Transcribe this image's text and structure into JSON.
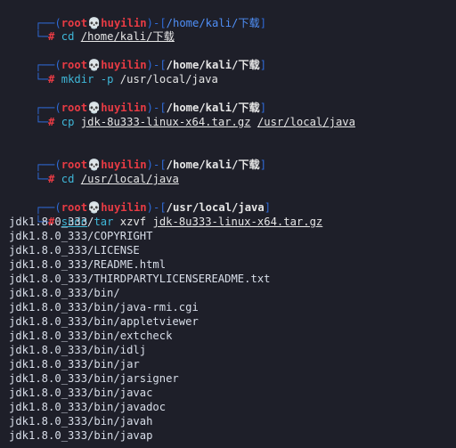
{
  "prompt": {
    "top_prefix": "┌──(",
    "user": "root",
    "skull": "💀",
    "host": "huyilin",
    "sep": ")-[",
    "close": "]",
    "bottom": "└─",
    "hash": "#"
  },
  "blocks": [
    {
      "cwd": "/home/kali/下载",
      "cmd": "cd",
      "args": [
        "/home/kali/下载"
      ]
    },
    {
      "cwd": "/home/kali/下载",
      "cmd": "mkdir",
      "args": [
        "-p",
        "/usr/local/java"
      ]
    },
    {
      "cwd": "/home/kali/下载",
      "cmd": "cp",
      "args": [
        "jdk-8u333-linux-x64.tar.gz",
        "/usr/local/java"
      ]
    },
    {
      "cwd": "/home/kali/下载",
      "cmd": "cd",
      "args": [
        "/usr/local/java"
      ]
    },
    {
      "cwd": "/usr/local/java",
      "cmd": "sudo",
      "args": [
        "tar",
        "xzvf",
        "jdk-8u333-linux-x64.tar.gz"
      ]
    }
  ],
  "output": [
    "jdk1.8.0_333/",
    "jdk1.8.0_333/COPYRIGHT",
    "jdk1.8.0_333/LICENSE",
    "jdk1.8.0_333/README.html",
    "jdk1.8.0_333/THIRDPARTYLICENSEREADME.txt",
    "jdk1.8.0_333/bin/",
    "jdk1.8.0_333/bin/java-rmi.cgi",
    "jdk1.8.0_333/bin/appletviewer",
    "jdk1.8.0_333/bin/extcheck",
    "jdk1.8.0_333/bin/idlj",
    "jdk1.8.0_333/bin/jar",
    "jdk1.8.0_333/bin/jarsigner",
    "jdk1.8.0_333/bin/javac",
    "jdk1.8.0_333/bin/javadoc",
    "jdk1.8.0_333/bin/javah",
    "jdk1.8.0_333/bin/javap"
  ],
  "colors": {
    "background": "#1e1f29",
    "frame": "#2f6bd8",
    "user": "#e83b44",
    "command": "#3fb8d9",
    "text": "#d8dee9"
  }
}
